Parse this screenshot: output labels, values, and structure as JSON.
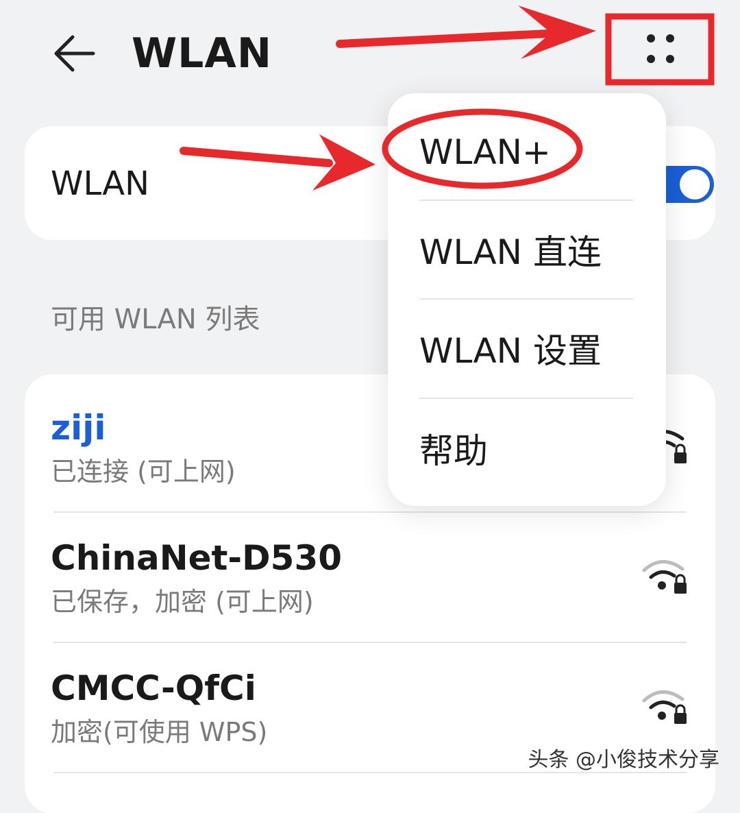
{
  "header": {
    "title": "WLAN",
    "back_icon": "back-arrow-icon",
    "more_icon": "more-dots-icon"
  },
  "wlan_toggle": {
    "label": "WLAN",
    "enabled": true
  },
  "section_title": "可用 WLAN 列表",
  "networks": [
    {
      "name": "ziji",
      "status": "已连接 (可上网)",
      "connected": true,
      "icon": "wifi-lock-icon"
    },
    {
      "name": "ChinaNet-D530",
      "status": "已保存，加密 (可上网)",
      "connected": false,
      "icon": "wifi-lock-icon"
    },
    {
      "name": "CMCC-QfCi",
      "status": "加密(可使用 WPS)",
      "connected": false,
      "icon": "wifi-lock-icon"
    }
  ],
  "menu": {
    "items": [
      {
        "label": "WLAN+"
      },
      {
        "label": "WLAN 直连"
      },
      {
        "label": "WLAN 设置"
      },
      {
        "label": "帮助"
      }
    ]
  },
  "watermark": "头条 @小俊技术分享",
  "colors": {
    "accent": "#1a5fd6",
    "annotation": "#e8292b",
    "background": "#f1f2f4",
    "card": "#ffffff",
    "secondary_text": "#7a7a7a"
  }
}
